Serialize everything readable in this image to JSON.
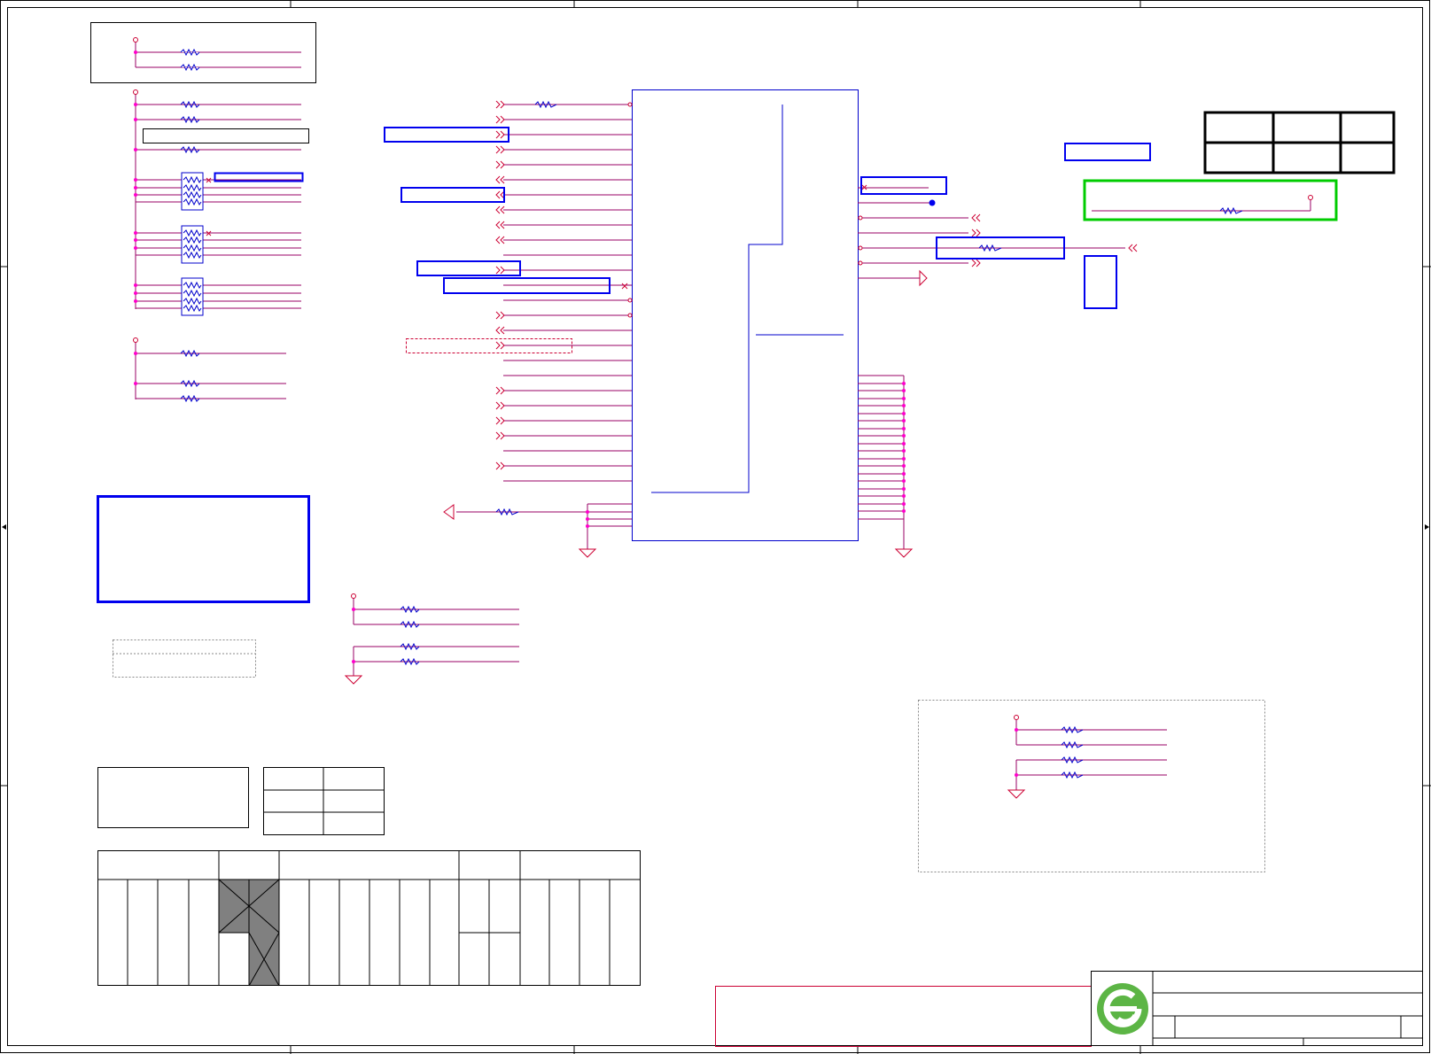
{
  "schematic": {
    "kind": "electrical-schematic-sheet",
    "text_labels": [],
    "colors": {
      "wire": "#cc0033",
      "wire_alt": "#990066",
      "component": "#0000cc",
      "highlight_box": "#0000ee",
      "note_box": "#00cc00",
      "title_frame": "#000000",
      "junction": "#ff00cc",
      "logo": "#5cb545",
      "hatched_cell": "#808080"
    },
    "icons": [
      "ground-symbol-icon",
      "power-port-icon",
      "resistor-icon",
      "resistor-array-icon",
      "off-page-connector-icon",
      "junction-dot-icon",
      "no-connect-icon",
      "company-logo-icon"
    ],
    "title_block": {
      "logo": "company-logo-icon",
      "fields": []
    }
  }
}
